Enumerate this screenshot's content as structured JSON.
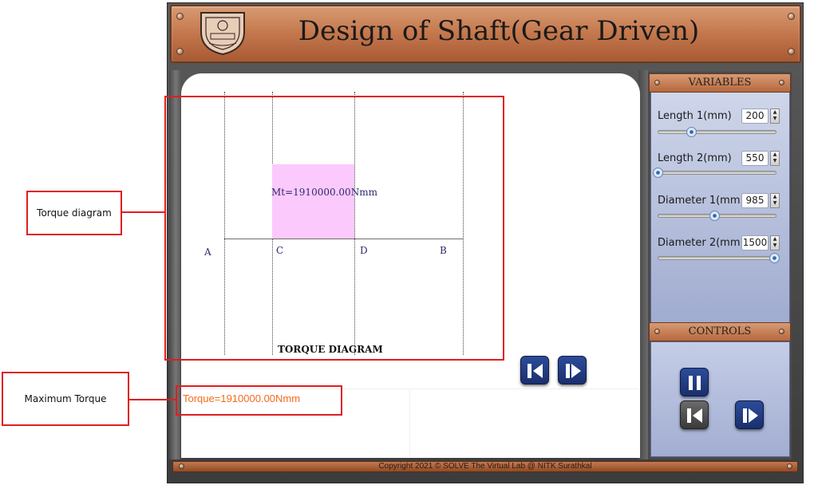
{
  "app": {
    "title": "Design of Shaft(Gear Driven)",
    "footer": "Copyright 2021 © SOLVE The Virtual Lab @ NITK Surathkal"
  },
  "diagram": {
    "moment_label": "Mt=1910000.00Nmm",
    "points": [
      "A",
      "C",
      "D",
      "B"
    ],
    "title": "TORQUE DIAGRAM",
    "result": "Torque=1910000.00Nmm"
  },
  "annotations": {
    "torque_diagram": "Torque diagram",
    "maximum_torque": "Maximum Torque"
  },
  "variables": {
    "header": "VARIABLES",
    "items": [
      {
        "label": "Length 1(mm)",
        "value": "200",
        "level": 0.3
      },
      {
        "label": "Length 2(mm)",
        "value": "550",
        "level": 0.0
      },
      {
        "label": "Diameter 1(mm",
        "value": "985",
        "level": 0.48
      },
      {
        "label": "Diameter 2(mm",
        "value": "1500",
        "level": 1.0
      }
    ]
  },
  "controls": {
    "header": "CONTROLS",
    "buttons": [
      "pause",
      "step-back",
      "step-forward"
    ]
  },
  "colors": {
    "accent_orange": "#f26b1d",
    "torque_fill": "#fcc9fc",
    "annotation_red": "#e01e1e",
    "button_blue": "#1a2f6e"
  }
}
